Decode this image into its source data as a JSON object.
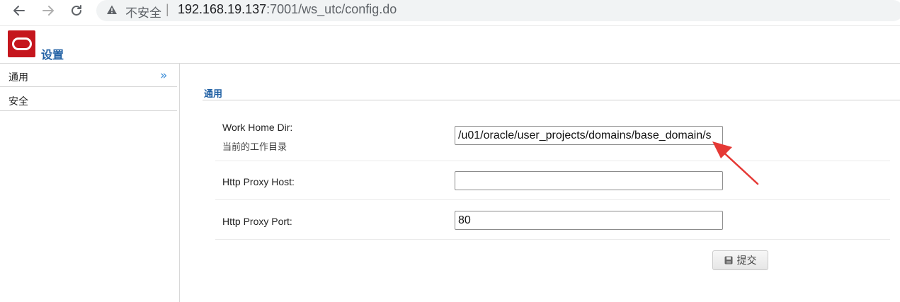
{
  "browser": {
    "security_label": "不安全",
    "url_host": "192.168.19.137",
    "url_rest": ":7001/ws_utc/config.do",
    "icons": [
      "back-icon",
      "forward-icon",
      "reload-icon",
      "warning-icon"
    ]
  },
  "header": {
    "title": "设置",
    "logo": "oracle-logo",
    "logo_color": "#c5161d",
    "title_color": "#1f5fa3"
  },
  "sidebar": {
    "items": [
      {
        "label": "通用",
        "expand_icon": "»"
      },
      {
        "label": "安全"
      }
    ]
  },
  "main": {
    "section_title": "通用",
    "fields": [
      {
        "label": "Work Home Dir:",
        "sublabel": "当前的工作目录",
        "value": "/u01/oracle/user_projects/domains/base_domain/s"
      },
      {
        "label": "Http Proxy Host:",
        "value": ""
      },
      {
        "label": "Http Proxy Port:",
        "value": "80"
      }
    ],
    "submit_label": "提交"
  },
  "colors": {
    "accent": "#1f5fa3",
    "chevron": "#3d8ed8",
    "annotation_arrow": "#e53935"
  }
}
